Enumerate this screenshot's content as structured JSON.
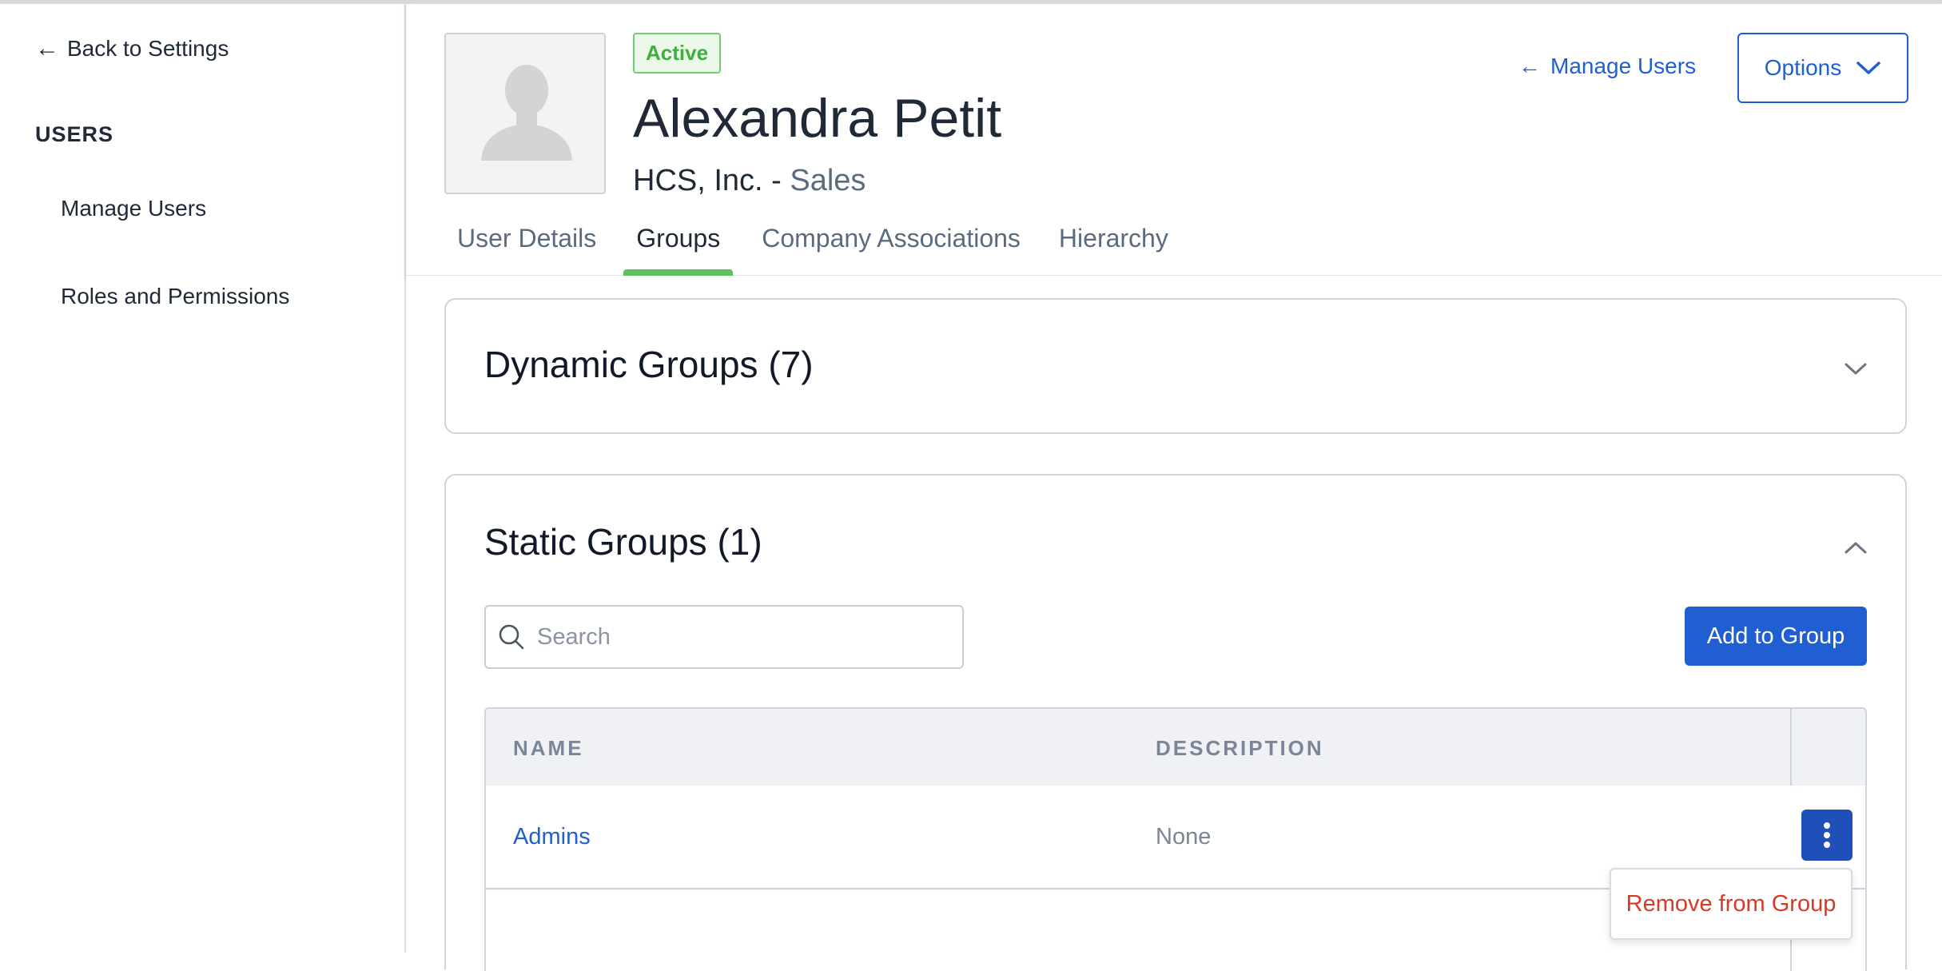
{
  "sidebar": {
    "back_label": "Back to Settings",
    "section_title": "USERS",
    "items": [
      {
        "label": "Manage Users"
      },
      {
        "label": "Roles and Permissions"
      }
    ]
  },
  "header": {
    "status_badge": "Active",
    "user_name": "Alexandra Petit",
    "company": "HCS, Inc. - ",
    "department": "Sales",
    "manage_users_link": "Manage Users",
    "options_label": "Options",
    "tabs": [
      {
        "label": "User Details",
        "active": false
      },
      {
        "label": "Groups",
        "active": true
      },
      {
        "label": "Company Associations",
        "active": false
      },
      {
        "label": "Hierarchy",
        "active": false
      }
    ]
  },
  "dynamic_groups": {
    "title": "Dynamic Groups (7)",
    "expanded": false
  },
  "static_groups": {
    "title": "Static Groups (1)",
    "expanded": true,
    "search": {
      "placeholder": "Search",
      "value": ""
    },
    "add_button": "Add to Group",
    "table": {
      "columns": [
        "NAME",
        "DESCRIPTION"
      ],
      "rows": [
        {
          "name": "Admins",
          "description": "None"
        }
      ]
    },
    "row_menu": {
      "items": [
        "Remove from Group"
      ]
    }
  },
  "colors": {
    "primary": "#1f5fd1",
    "active_tab": "#5cc35c",
    "status_green": "#3fae3f",
    "danger": "#d73a27"
  }
}
